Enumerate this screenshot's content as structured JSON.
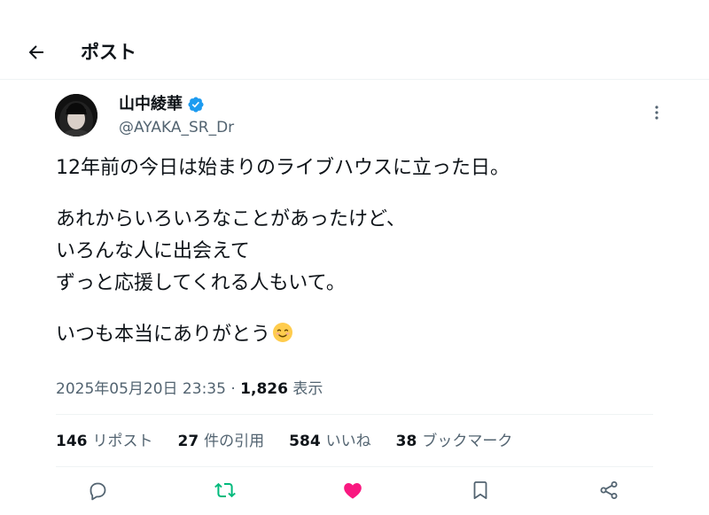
{
  "header": {
    "title": "ポスト",
    "back_icon": "arrow-left-icon"
  },
  "author": {
    "display_name": "山中綾華",
    "handle": "@AYAKA_SR_Dr",
    "verified": true,
    "verified_color": "#1d9bf0"
  },
  "tweet": {
    "lines": [
      "12年前の今日は始まりのライブハウスに立った日。",
      "",
      "あれからいろいろなことがあったけど、",
      "いろんな人に出会えて",
      "ずっと応援してくれる人もいて。",
      "",
      "いつも本当にありがとう"
    ],
    "emoji": "smiling-face-icon"
  },
  "meta": {
    "timestamp": "2025年05月20日 23:35",
    "separator": "·",
    "views": "1,826",
    "views_label": "表示"
  },
  "stats": [
    {
      "count": "146",
      "label": "リポスト"
    },
    {
      "count": "27",
      "label": "件の引用"
    },
    {
      "count": "584",
      "label": "いいね"
    },
    {
      "count": "38",
      "label": "ブックマーク"
    }
  ],
  "actions": [
    {
      "name": "reply",
      "icon": "reply-icon",
      "active": false
    },
    {
      "name": "repost",
      "icon": "repost-icon",
      "active": true,
      "color": "#00ba7c"
    },
    {
      "name": "like",
      "icon": "heart-icon",
      "active": true,
      "color": "#f91880"
    },
    {
      "name": "bookmark",
      "icon": "bookmark-icon",
      "active": false
    },
    {
      "name": "share",
      "icon": "share-icon",
      "active": false
    }
  ]
}
